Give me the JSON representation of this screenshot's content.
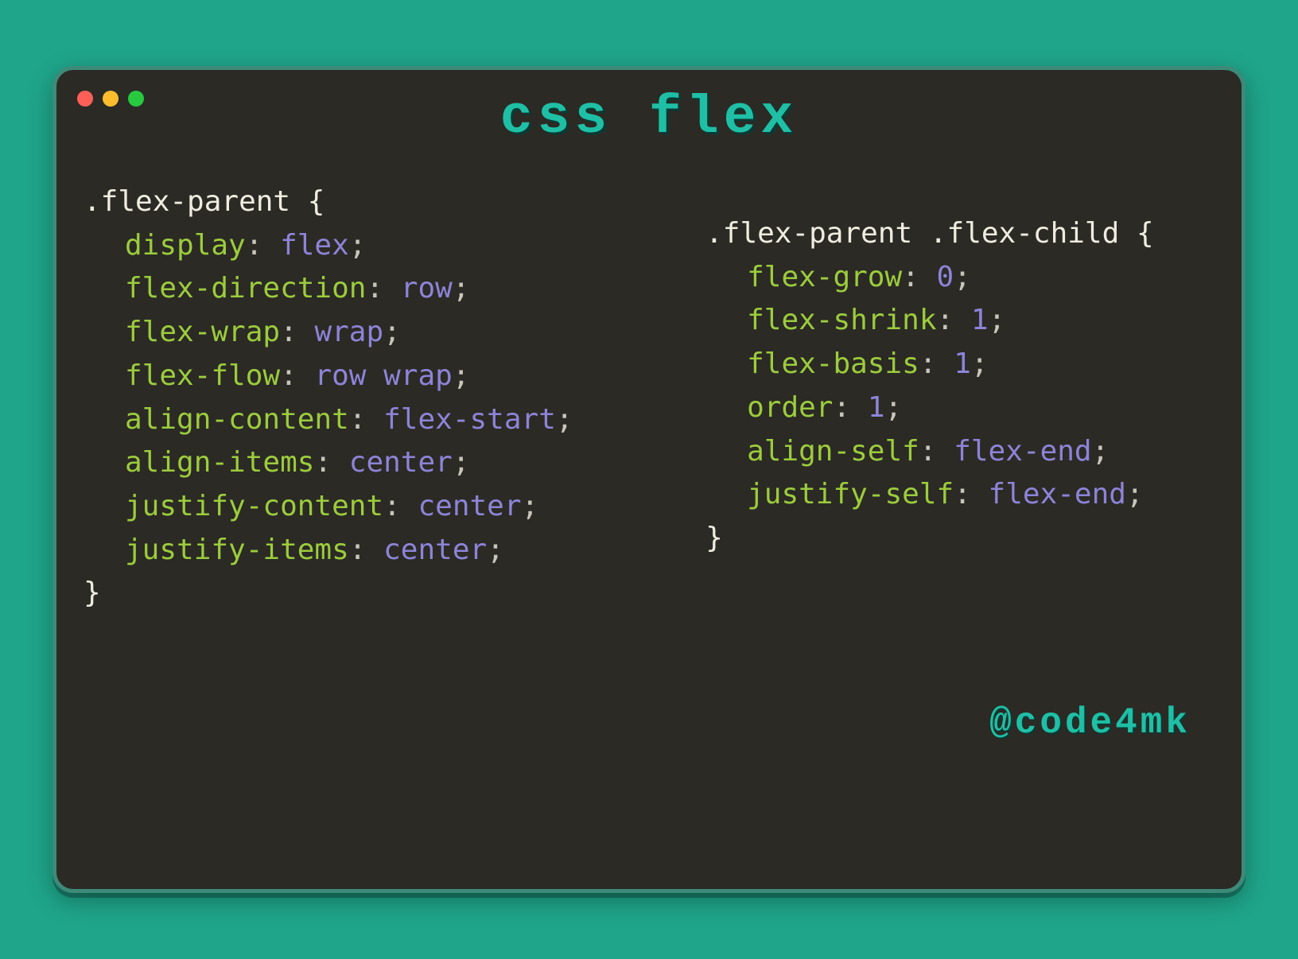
{
  "title": "css flex",
  "credit": "@code4mk",
  "colors": {
    "background": "#1fa58a",
    "window_bg": "#2b2a25",
    "window_border": "#3e8a79",
    "accent": "#1fbfa5",
    "property": "#9ccc3c",
    "value": "#8d84d8",
    "text": "#e8e6df"
  },
  "traffic": {
    "red": "#ff5f56",
    "yellow": "#ffbd2e",
    "green": "#27c93f"
  },
  "left": {
    "selector": ".flex-parent {",
    "close": "}",
    "decls": [
      {
        "prop": "display",
        "val": "flex"
      },
      {
        "prop": "flex-direction",
        "val": "row"
      },
      {
        "prop": "flex-wrap",
        "val": "wrap"
      },
      {
        "prop": "flex-flow",
        "val": "row wrap"
      },
      {
        "prop": "align-content",
        "val": "flex-start"
      },
      {
        "prop": "align-items",
        "val": "center"
      },
      {
        "prop": "justify-content",
        "val": "center"
      },
      {
        "prop": "justify-items",
        "val": "center"
      }
    ]
  },
  "right": {
    "selector": ".flex-parent .flex-child {",
    "close": "}",
    "decls": [
      {
        "prop": "flex-grow",
        "val": "0"
      },
      {
        "prop": "flex-shrink",
        "val": "1"
      },
      {
        "prop": "flex-basis",
        "val": "1"
      },
      {
        "prop": "order",
        "val": "1"
      },
      {
        "prop": "align-self",
        "val": "flex-end"
      },
      {
        "prop": "justify-self",
        "val": "flex-end"
      }
    ]
  }
}
